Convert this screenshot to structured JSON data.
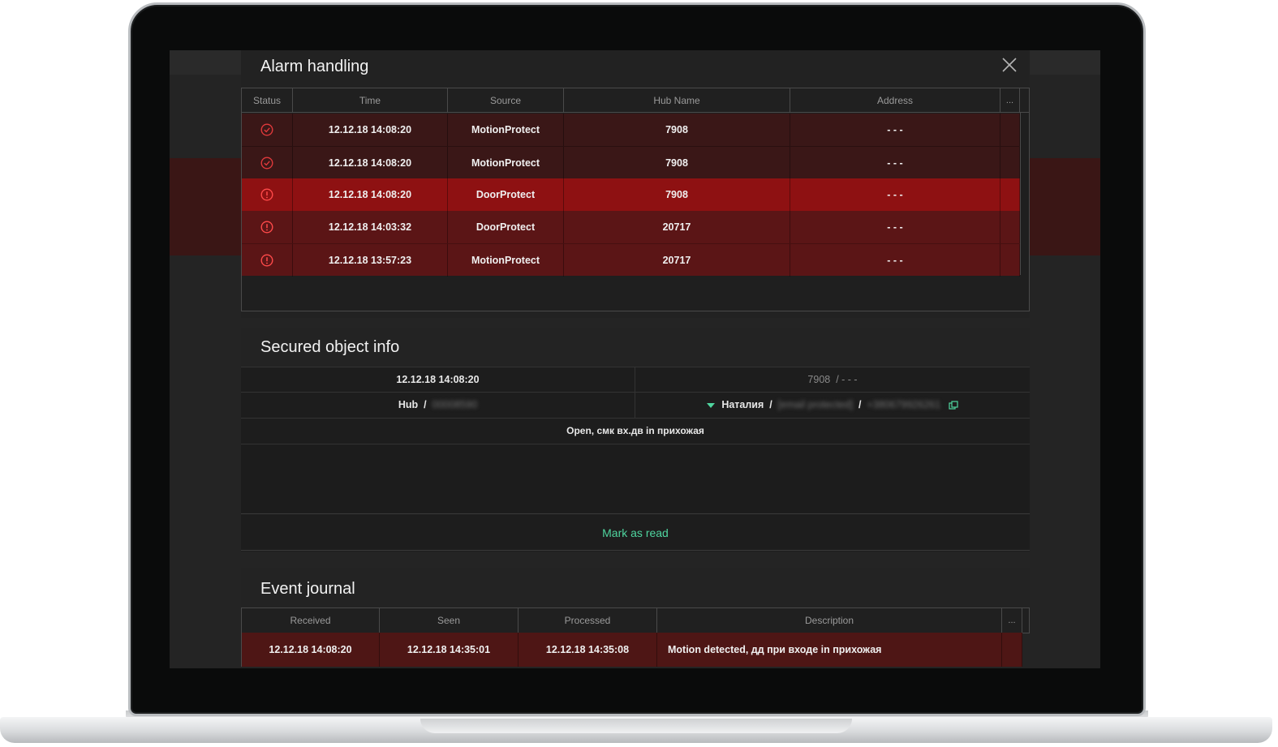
{
  "alarm_panel": {
    "title": "Alarm handling",
    "close_icon": "close-icon",
    "columns": [
      "Status",
      "Time",
      "Source",
      "Hub Name",
      "Address",
      "..."
    ],
    "rows": [
      {
        "status": "check-circle-icon",
        "time": "12.12.18  14:08:20",
        "source": "MotionProtect",
        "hub": "7908",
        "address": "- - -",
        "state": "handled"
      },
      {
        "status": "check-circle-icon",
        "time": "12.12.18  14:08:20",
        "source": "MotionProtect",
        "hub": "7908",
        "address": "- - -",
        "state": "handled"
      },
      {
        "status": "alert-circle-icon",
        "time": "12.12.18  14:08:20",
        "source": "DoorProtect",
        "hub": "7908",
        "address": "- - -",
        "state": "selected"
      },
      {
        "status": "alert-circle-icon",
        "time": "12.12.18  14:03:32",
        "source": "DoorProtect",
        "hub": "20717",
        "address": "- - -",
        "state": "alarm"
      },
      {
        "status": "alert-circle-icon",
        "time": "12.12.18  13:57:23",
        "source": "MotionProtect",
        "hub": "20717",
        "address": "- - -",
        "state": "alarm"
      }
    ]
  },
  "info_panel": {
    "title": "Secured object info",
    "timestamp": "12.12.18 14:08:20",
    "hub_name": "7908",
    "address_sep": "/  - - -",
    "hub_label": "Hub",
    "hub_id": "00008590",
    "user_name": "Наталия",
    "user_email": "[email protected]",
    "user_phone": "+380679926261",
    "event_text": "Open, смк вх.дв in прихожая",
    "mark_read_label": "Mark as read"
  },
  "journal_panel": {
    "title": "Event journal",
    "columns": [
      "Received",
      "Seen",
      "Processed",
      "Description",
      "..."
    ],
    "rows": [
      {
        "received": "12.12.18  14:08:20",
        "seen": "12.12.18  14:35:01",
        "processed": "12.12.18  14:35:08",
        "description": "Motion detected, дд при входе in прихожая"
      }
    ]
  },
  "colors": {
    "accent_green": "#4fd59f",
    "alarm_red": "#e0393b",
    "selected_row": "#8e1112",
    "handled_row": "#3a1717",
    "alarm_row": "#5b1516"
  }
}
